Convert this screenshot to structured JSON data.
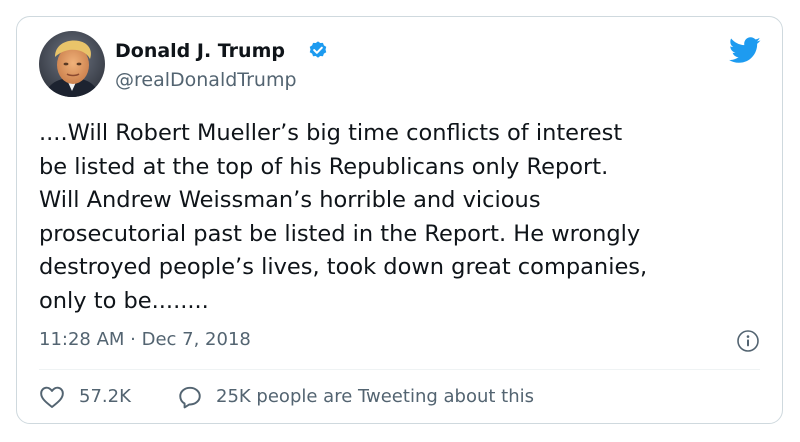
{
  "author": {
    "display_name": "Donald J. Trump",
    "handle": "@realDonaldTrump",
    "verified": true,
    "avatar": "avatar-photo"
  },
  "tweet": {
    "lines": [
      "....Will Robert Mueller’s big time conflicts of interest",
      "be listed at the top of his Republicans only Report.",
      "Will Andrew Weissman’s horrible and vicious",
      "prosecutorial past be listed in the Report. He wrongly",
      "destroyed people’s lives, took down great companies,",
      "only to be........"
    ],
    "timestamp": "11:28 AM · Dec 7, 2018"
  },
  "actions": {
    "likes": "57.2K",
    "conversation": "25K people are Tweeting about this"
  },
  "icons": {
    "brand": "twitter-bird-icon",
    "verified": "verified-badge-icon",
    "info": "info-icon",
    "like": "heart-icon",
    "reply": "speech-bubble-icon"
  },
  "colors": {
    "brand_blue": "#1d9bf0",
    "text": "#0f1419",
    "secondary_text": "#536471",
    "border": "#cfd9de"
  }
}
